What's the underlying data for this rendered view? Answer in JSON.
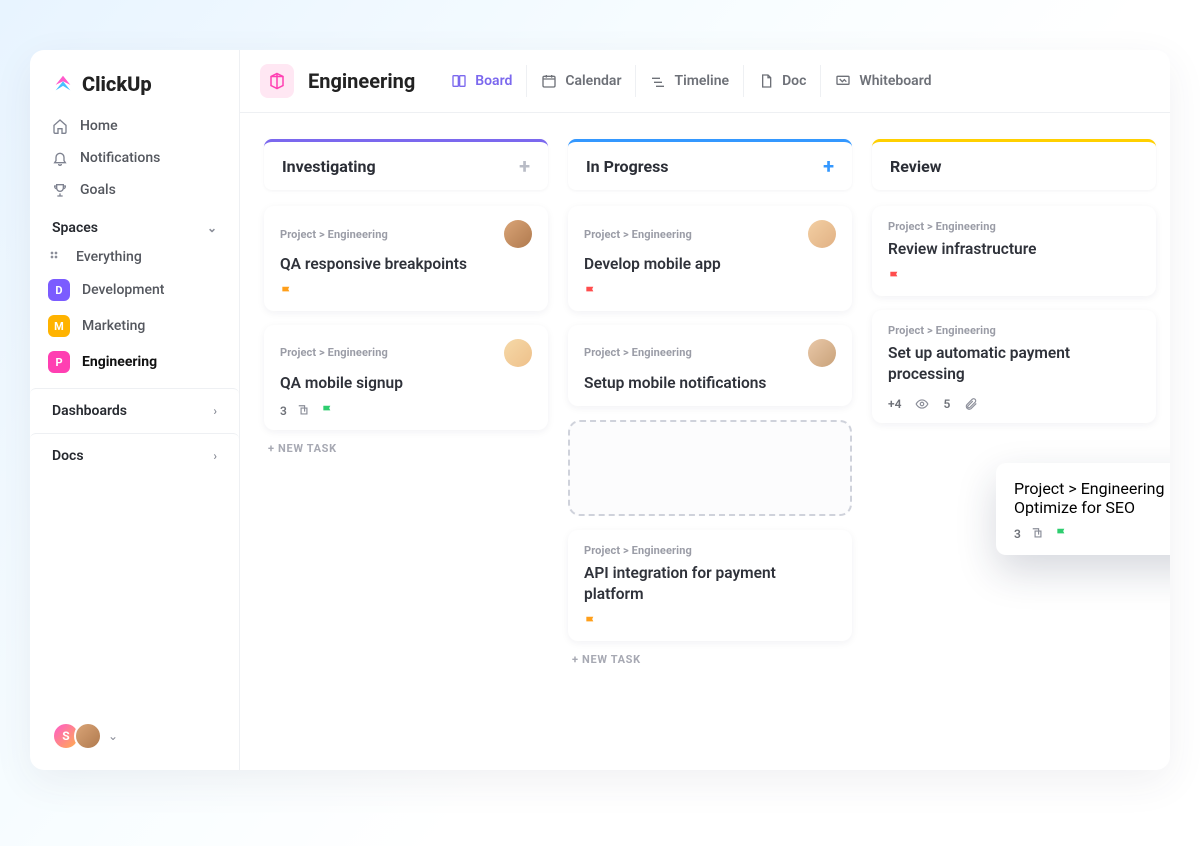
{
  "brand": {
    "name": "ClickUp"
  },
  "sidebar": {
    "nav": [
      {
        "label": "Home",
        "name": "nav-home",
        "icon": "home-icon"
      },
      {
        "label": "Notifications",
        "name": "nav-notifications",
        "icon": "bell-icon"
      },
      {
        "label": "Goals",
        "name": "nav-goals",
        "icon": "trophy-icon"
      }
    ],
    "spaces_header": "Spaces",
    "everything_label": "Everything",
    "spaces": [
      {
        "label": "Development",
        "letter": "D",
        "color": "#7b5cff",
        "name": "space-development",
        "active": false
      },
      {
        "label": "Marketing",
        "letter": "M",
        "color": "#ffb300",
        "name": "space-marketing",
        "active": false
      },
      {
        "label": "Engineering",
        "letter": "P",
        "color": "#ff3fb2",
        "name": "space-engineering",
        "active": true
      }
    ],
    "dashboards_label": "Dashboards",
    "docs_label": "Docs",
    "avatars": [
      {
        "letter": "S",
        "bg": "av-grad"
      },
      {
        "letter": "",
        "bg": "av-bg1"
      }
    ]
  },
  "topbar": {
    "workspace": "Engineering",
    "views": [
      {
        "label": "Board",
        "name": "view-board",
        "icon": "board-icon",
        "active": true
      },
      {
        "label": "Calendar",
        "name": "view-calendar",
        "icon": "calendar-icon",
        "active": false
      },
      {
        "label": "Timeline",
        "name": "view-timeline",
        "icon": "timeline-icon",
        "active": false
      },
      {
        "label": "Doc",
        "name": "view-doc",
        "icon": "doc-icon",
        "active": false
      },
      {
        "label": "Whiteboard",
        "name": "view-whiteboard",
        "icon": "whiteboard-icon",
        "active": false
      }
    ]
  },
  "board": {
    "breadcrumb": "Project > Engineering",
    "new_task_label": "+ NEW TASK",
    "columns": [
      {
        "title": "Investigating",
        "color": "#7b68ee",
        "plus_color": "#b9bcc6",
        "cards": [
          {
            "title": "QA responsive breakpoints",
            "flag": "#ff9f1a",
            "avatar": "av-bg1"
          },
          {
            "title": "QA mobile signup",
            "flag": "#2ecd6f",
            "avatar": "av-bg4",
            "subtasks": "3"
          }
        ],
        "show_new_task": true
      },
      {
        "title": "In Progress",
        "color": "#3498ff",
        "plus_color": "#3498ff",
        "cards": [
          {
            "title": "Develop mobile app",
            "flag": "#ff4d4d",
            "avatar": "av-bg2"
          },
          {
            "title": "Setup mobile notifications",
            "avatar": "av-bg3"
          }
        ],
        "drop_area": true,
        "tail_card": {
          "title": "API integration for payment platform",
          "flag": "#ff9f1a"
        },
        "show_new_task": true
      },
      {
        "title": "Review",
        "color": "#ffd000",
        "plus_color": "transparent",
        "cards": [
          {
            "title": "Review infrastructure",
            "flag": "#ff4d4d"
          },
          {
            "title": "Set up automatic payment processing",
            "attachments": {
              "extra": "+4",
              "count": "5"
            }
          }
        ]
      }
    ],
    "float_card": {
      "title": "Optimize for SEO",
      "avatar": "av-bg4",
      "subtasks": "3",
      "flag": "#2ecd6f"
    }
  }
}
